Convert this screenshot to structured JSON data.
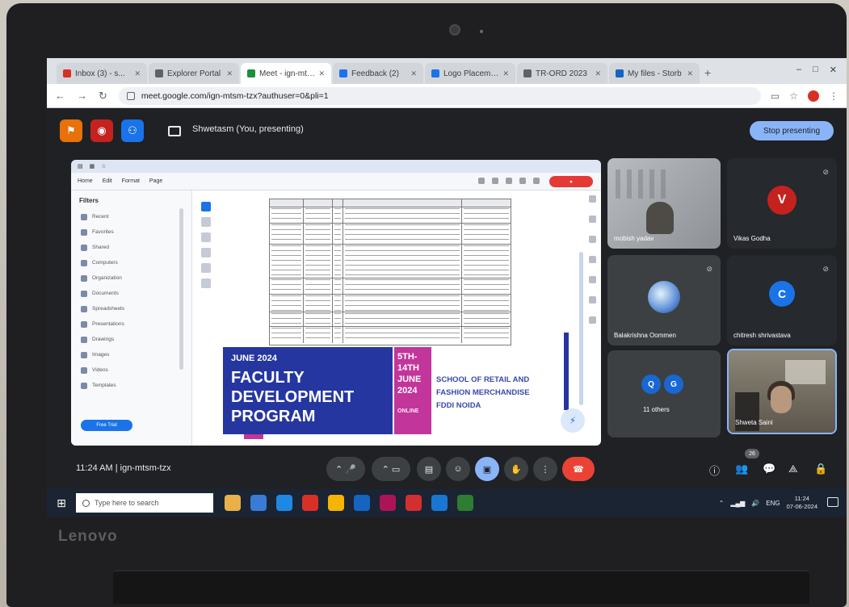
{
  "browser": {
    "tabs": [
      {
        "label": "Inbox (3) - s...",
        "color": "#d93025",
        "active": false
      },
      {
        "label": "Explorer Portal",
        "color": "#5f6368",
        "active": false
      },
      {
        "label": "Meet - ign-mtsm",
        "color": "#1e8e3e",
        "active": true
      },
      {
        "label": "Feedback (2)",
        "color": "#1a73e8",
        "active": false
      },
      {
        "label": "Logo Placeme...",
        "color": "#1a73e8",
        "active": false
      },
      {
        "label": "TR-ORD 2023",
        "color": "#5f6368",
        "active": false
      },
      {
        "label": "My files - Storb",
        "color": "#1565c0",
        "active": false
      }
    ],
    "new_tab": "+",
    "window_controls": {
      "minimize": "–",
      "maximize": "□",
      "close": "✕"
    },
    "url": "meet.google.com/ign-mtsm-tzx?authuser=0&pli=1"
  },
  "meet": {
    "presenting_label": "Shwetasm (You, presenting)",
    "stop_presenting": "Stop presenting",
    "top_badges": [
      {
        "icon": "flag-icon",
        "color": "#e8710a",
        "glyph": "⚑"
      },
      {
        "icon": "record-icon",
        "color": "#c5221f",
        "glyph": "◉"
      },
      {
        "icon": "people-icon",
        "color": "#1a73e8",
        "glyph": "⚇"
      }
    ],
    "time_code": "11:24 AM  |  ign-mtsm-tzx",
    "participants": [
      {
        "name": "mobish yadav",
        "type": "photo"
      },
      {
        "name": "Vikas Godha",
        "initial": "V",
        "color": "#c5221f",
        "type": "avatar"
      },
      {
        "name": "Balakrishna Oommen",
        "type": "globe"
      },
      {
        "name": "chitresh shrivastava",
        "initial": "C",
        "color": "#1a73e8",
        "type": "avatar"
      },
      {
        "name": "11 others",
        "initials": [
          "Q",
          "G"
        ],
        "type": "others"
      },
      {
        "name": "Shweta Saini",
        "type": "photo"
      }
    ],
    "participant_count": "26",
    "controls": [
      "mic",
      "camera",
      "captions",
      "emoji",
      "present",
      "raise-hand",
      "more",
      "leave"
    ],
    "control_glyphs": {
      "mic": "⌃ 🎤",
      "camera": "⌃ ▭",
      "captions": "▤",
      "emoji": "☺",
      "present": "▣",
      "raise-hand": "✋",
      "more": "⋮",
      "leave": "☎"
    },
    "right_icons": {
      "info": "ⓘ",
      "people": "👥",
      "chat": "💬",
      "activities": "⟁",
      "lock": "🔒"
    }
  },
  "shared_doc": {
    "sidebar_title": "Filters",
    "sidebar_items": [
      "Recent",
      "Favorites",
      "Shared",
      "Computers",
      "Organization",
      "Documents",
      "Spreadsheets",
      "Presentations",
      "Drawings",
      "Images",
      "Videos",
      "Templates"
    ],
    "sidebar_footer": "Free Trial",
    "ribbon_items": [
      "Home",
      "Edit",
      "Format",
      "Page"
    ]
  },
  "flyer": {
    "month": "JUNE 2024",
    "title": [
      "FACULTY",
      "DEVELOPMENT",
      "PROGRAM"
    ],
    "dates": [
      "5TH-",
      "14TH",
      "JUNE",
      "2024"
    ],
    "mode": "ONLINE",
    "school": [
      "SCHOOL OF RETAIL AND",
      "FASHION MERCHANDISE",
      "FDDI NOIDA"
    ]
  },
  "taskbar": {
    "search_placeholder": "Type here to search",
    "apps": [
      "#e8b04a",
      "#3a7bd5",
      "#1e88e5",
      "#d93025",
      "#f4b400",
      "#1565c0",
      "#ad1457",
      "#d32f2f",
      "#1976d2",
      "#2e7d32"
    ],
    "time": "11:24",
    "date": "07-06-2024",
    "lang": "ENG"
  },
  "device": {
    "brand": "Lenovo"
  }
}
